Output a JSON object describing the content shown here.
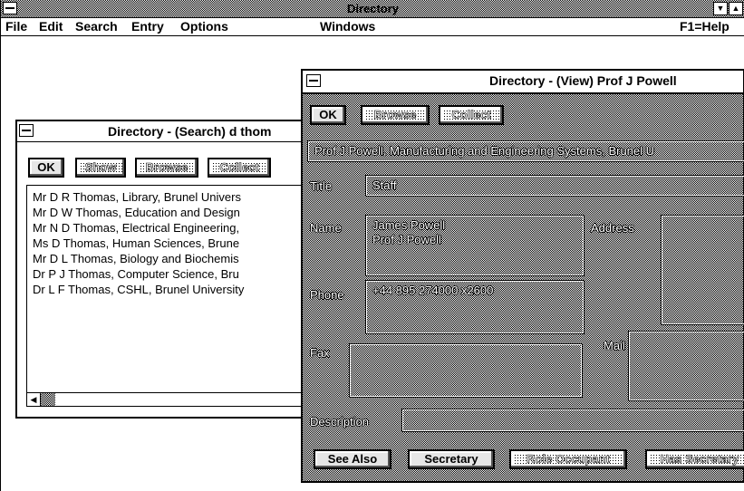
{
  "app": {
    "title": "Directory",
    "menu": [
      "File",
      "Edit",
      "Search",
      "Entry",
      "Options",
      "Windows"
    ],
    "help": "F1=Help"
  },
  "search_window": {
    "title": "Directory - (Search) d thom",
    "buttons": [
      "OK",
      "Show",
      "Browse",
      "Collect"
    ],
    "results": [
      "Mr D R Thomas, Library, Brunel Univers",
      "Mr D W Thomas, Education and Design",
      "Mr N D Thomas, Electrical Engineering,",
      "Ms D Thomas, Human Sciences, Brune",
      "Mr D L Thomas, Biology and Biochemis",
      "Dr P J Thomas, Computer Science, Bru",
      "Dr L F Thomas, CSHL, Brunel University"
    ]
  },
  "view_window": {
    "title": "Directory - (View) Prof J Powell",
    "buttons": [
      "OK",
      "Browse",
      "Collect"
    ],
    "header": "Prof J Powell, Manufacturing and Engineering Systems, Brunel U",
    "labels": {
      "title": "Title",
      "name": "Name",
      "address": "Address",
      "phone": "Phone",
      "fax": "Fax",
      "mail": "Mail",
      "description": "Description"
    },
    "values": {
      "title": "Staff",
      "name_lines": [
        "James Powell",
        "Prof J Powell"
      ],
      "phone": "+44 895 274000 x2600",
      "fax": "",
      "address": "",
      "mail": "",
      "description": ""
    },
    "bottom_buttons": [
      "See Also",
      "Secretary",
      "Role Occupant",
      "Has Secretary"
    ]
  }
}
